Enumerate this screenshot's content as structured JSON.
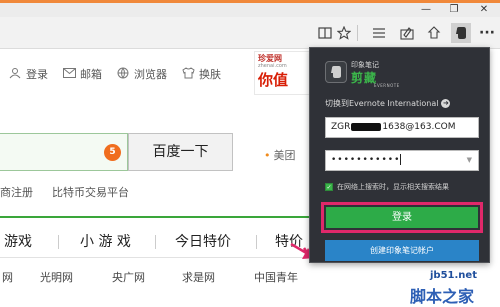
{
  "window": {
    "minimize_glyph": "—",
    "maximize_glyph": "❐",
    "close_glyph": "✕"
  },
  "toolbar": {
    "icons": [
      "reading-view-icon",
      "favorite-star-icon",
      "hub-icon",
      "web-note-icon",
      "share-icon",
      "evernote-extension-icon",
      "more-icon"
    ],
    "more_glyph": "···"
  },
  "topnav": {
    "items": [
      {
        "icon": "user-icon",
        "label": "登录"
      },
      {
        "icon": "mail-icon",
        "label": "邮箱"
      },
      {
        "icon": "browser-icon",
        "label": "浏览器"
      },
      {
        "icon": "skin-icon",
        "label": "换肤"
      }
    ]
  },
  "ad": {
    "logo": "珍爱网",
    "sub": "zhenai.com",
    "big": "你值"
  },
  "search": {
    "badge": "5",
    "button": "百度一下",
    "side_link": "美团"
  },
  "links": [
    "商注册",
    "比特币交易平台"
  ],
  "categories": [
    "游戏",
    "小 游 戏",
    "今日特价",
    "特价"
  ],
  "sites": [
    "网",
    "光明网",
    "央广网",
    "求是网",
    "中国青年"
  ],
  "evernote": {
    "brand_top": "印象笔记",
    "brand_mid": "剪藏",
    "brand_bot": "EVERNOTE",
    "switch_link": "切换到Evernote International",
    "email_prefix": "ZGR",
    "email_suffix": "1638@163.COM",
    "password_mask": "•••••••••••",
    "checkbox_label": "在网络上搜索时，显示相关搜索结果",
    "login_button": "登录",
    "create_button": "创建印象笔记帐户"
  },
  "watermark": {
    "url": "jb51.net",
    "cn": "脚本之家"
  },
  "colors": {
    "accent_green": "#2dab48",
    "highlight_pink": "#e0286a",
    "create_blue": "#2a84c8",
    "popup_bg": "#2f3137"
  }
}
